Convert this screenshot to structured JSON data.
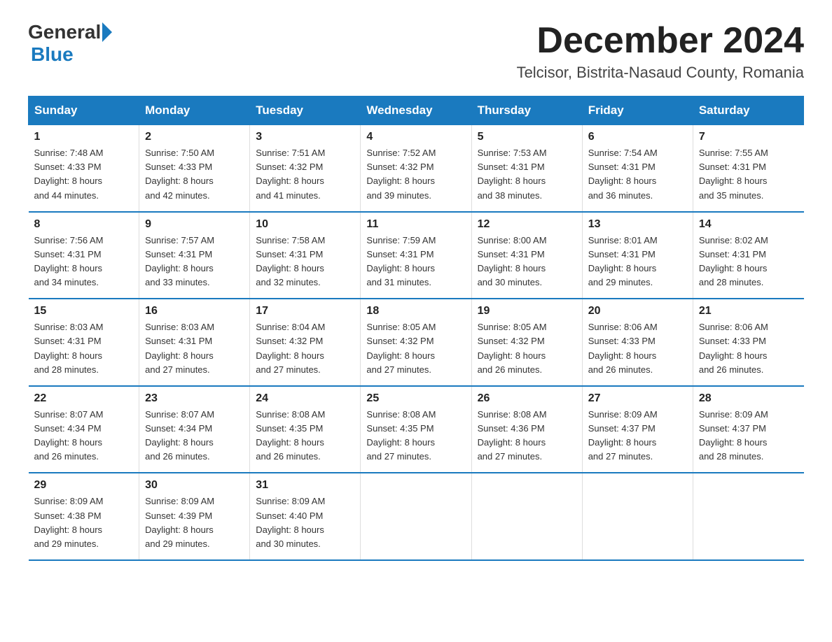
{
  "header": {
    "logo_general": "General",
    "logo_blue": "Blue",
    "month_title": "December 2024",
    "location": "Telcisor, Bistrita-Nasaud County, Romania"
  },
  "days_of_week": [
    "Sunday",
    "Monday",
    "Tuesday",
    "Wednesday",
    "Thursday",
    "Friday",
    "Saturday"
  ],
  "weeks": [
    [
      {
        "day": "1",
        "sunrise": "7:48 AM",
        "sunset": "4:33 PM",
        "daylight": "8 hours and 44 minutes."
      },
      {
        "day": "2",
        "sunrise": "7:50 AM",
        "sunset": "4:33 PM",
        "daylight": "8 hours and 42 minutes."
      },
      {
        "day": "3",
        "sunrise": "7:51 AM",
        "sunset": "4:32 PM",
        "daylight": "8 hours and 41 minutes."
      },
      {
        "day": "4",
        "sunrise": "7:52 AM",
        "sunset": "4:32 PM",
        "daylight": "8 hours and 39 minutes."
      },
      {
        "day": "5",
        "sunrise": "7:53 AM",
        "sunset": "4:31 PM",
        "daylight": "8 hours and 38 minutes."
      },
      {
        "day": "6",
        "sunrise": "7:54 AM",
        "sunset": "4:31 PM",
        "daylight": "8 hours and 36 minutes."
      },
      {
        "day": "7",
        "sunrise": "7:55 AM",
        "sunset": "4:31 PM",
        "daylight": "8 hours and 35 minutes."
      }
    ],
    [
      {
        "day": "8",
        "sunrise": "7:56 AM",
        "sunset": "4:31 PM",
        "daylight": "8 hours and 34 minutes."
      },
      {
        "day": "9",
        "sunrise": "7:57 AM",
        "sunset": "4:31 PM",
        "daylight": "8 hours and 33 minutes."
      },
      {
        "day": "10",
        "sunrise": "7:58 AM",
        "sunset": "4:31 PM",
        "daylight": "8 hours and 32 minutes."
      },
      {
        "day": "11",
        "sunrise": "7:59 AM",
        "sunset": "4:31 PM",
        "daylight": "8 hours and 31 minutes."
      },
      {
        "day": "12",
        "sunrise": "8:00 AM",
        "sunset": "4:31 PM",
        "daylight": "8 hours and 30 minutes."
      },
      {
        "day": "13",
        "sunrise": "8:01 AM",
        "sunset": "4:31 PM",
        "daylight": "8 hours and 29 minutes."
      },
      {
        "day": "14",
        "sunrise": "8:02 AM",
        "sunset": "4:31 PM",
        "daylight": "8 hours and 28 minutes."
      }
    ],
    [
      {
        "day": "15",
        "sunrise": "8:03 AM",
        "sunset": "4:31 PM",
        "daylight": "8 hours and 28 minutes."
      },
      {
        "day": "16",
        "sunrise": "8:03 AM",
        "sunset": "4:31 PM",
        "daylight": "8 hours and 27 minutes."
      },
      {
        "day": "17",
        "sunrise": "8:04 AM",
        "sunset": "4:32 PM",
        "daylight": "8 hours and 27 minutes."
      },
      {
        "day": "18",
        "sunrise": "8:05 AM",
        "sunset": "4:32 PM",
        "daylight": "8 hours and 27 minutes."
      },
      {
        "day": "19",
        "sunrise": "8:05 AM",
        "sunset": "4:32 PM",
        "daylight": "8 hours and 26 minutes."
      },
      {
        "day": "20",
        "sunrise": "8:06 AM",
        "sunset": "4:33 PM",
        "daylight": "8 hours and 26 minutes."
      },
      {
        "day": "21",
        "sunrise": "8:06 AM",
        "sunset": "4:33 PM",
        "daylight": "8 hours and 26 minutes."
      }
    ],
    [
      {
        "day": "22",
        "sunrise": "8:07 AM",
        "sunset": "4:34 PM",
        "daylight": "8 hours and 26 minutes."
      },
      {
        "day": "23",
        "sunrise": "8:07 AM",
        "sunset": "4:34 PM",
        "daylight": "8 hours and 26 minutes."
      },
      {
        "day": "24",
        "sunrise": "8:08 AM",
        "sunset": "4:35 PM",
        "daylight": "8 hours and 26 minutes."
      },
      {
        "day": "25",
        "sunrise": "8:08 AM",
        "sunset": "4:35 PM",
        "daylight": "8 hours and 27 minutes."
      },
      {
        "day": "26",
        "sunrise": "8:08 AM",
        "sunset": "4:36 PM",
        "daylight": "8 hours and 27 minutes."
      },
      {
        "day": "27",
        "sunrise": "8:09 AM",
        "sunset": "4:37 PM",
        "daylight": "8 hours and 27 minutes."
      },
      {
        "day": "28",
        "sunrise": "8:09 AM",
        "sunset": "4:37 PM",
        "daylight": "8 hours and 28 minutes."
      }
    ],
    [
      {
        "day": "29",
        "sunrise": "8:09 AM",
        "sunset": "4:38 PM",
        "daylight": "8 hours and 29 minutes."
      },
      {
        "day": "30",
        "sunrise": "8:09 AM",
        "sunset": "4:39 PM",
        "daylight": "8 hours and 29 minutes."
      },
      {
        "day": "31",
        "sunrise": "8:09 AM",
        "sunset": "4:40 PM",
        "daylight": "8 hours and 30 minutes."
      },
      null,
      null,
      null,
      null
    ]
  ],
  "labels": {
    "sunrise": "Sunrise:",
    "sunset": "Sunset:",
    "daylight": "Daylight:"
  }
}
